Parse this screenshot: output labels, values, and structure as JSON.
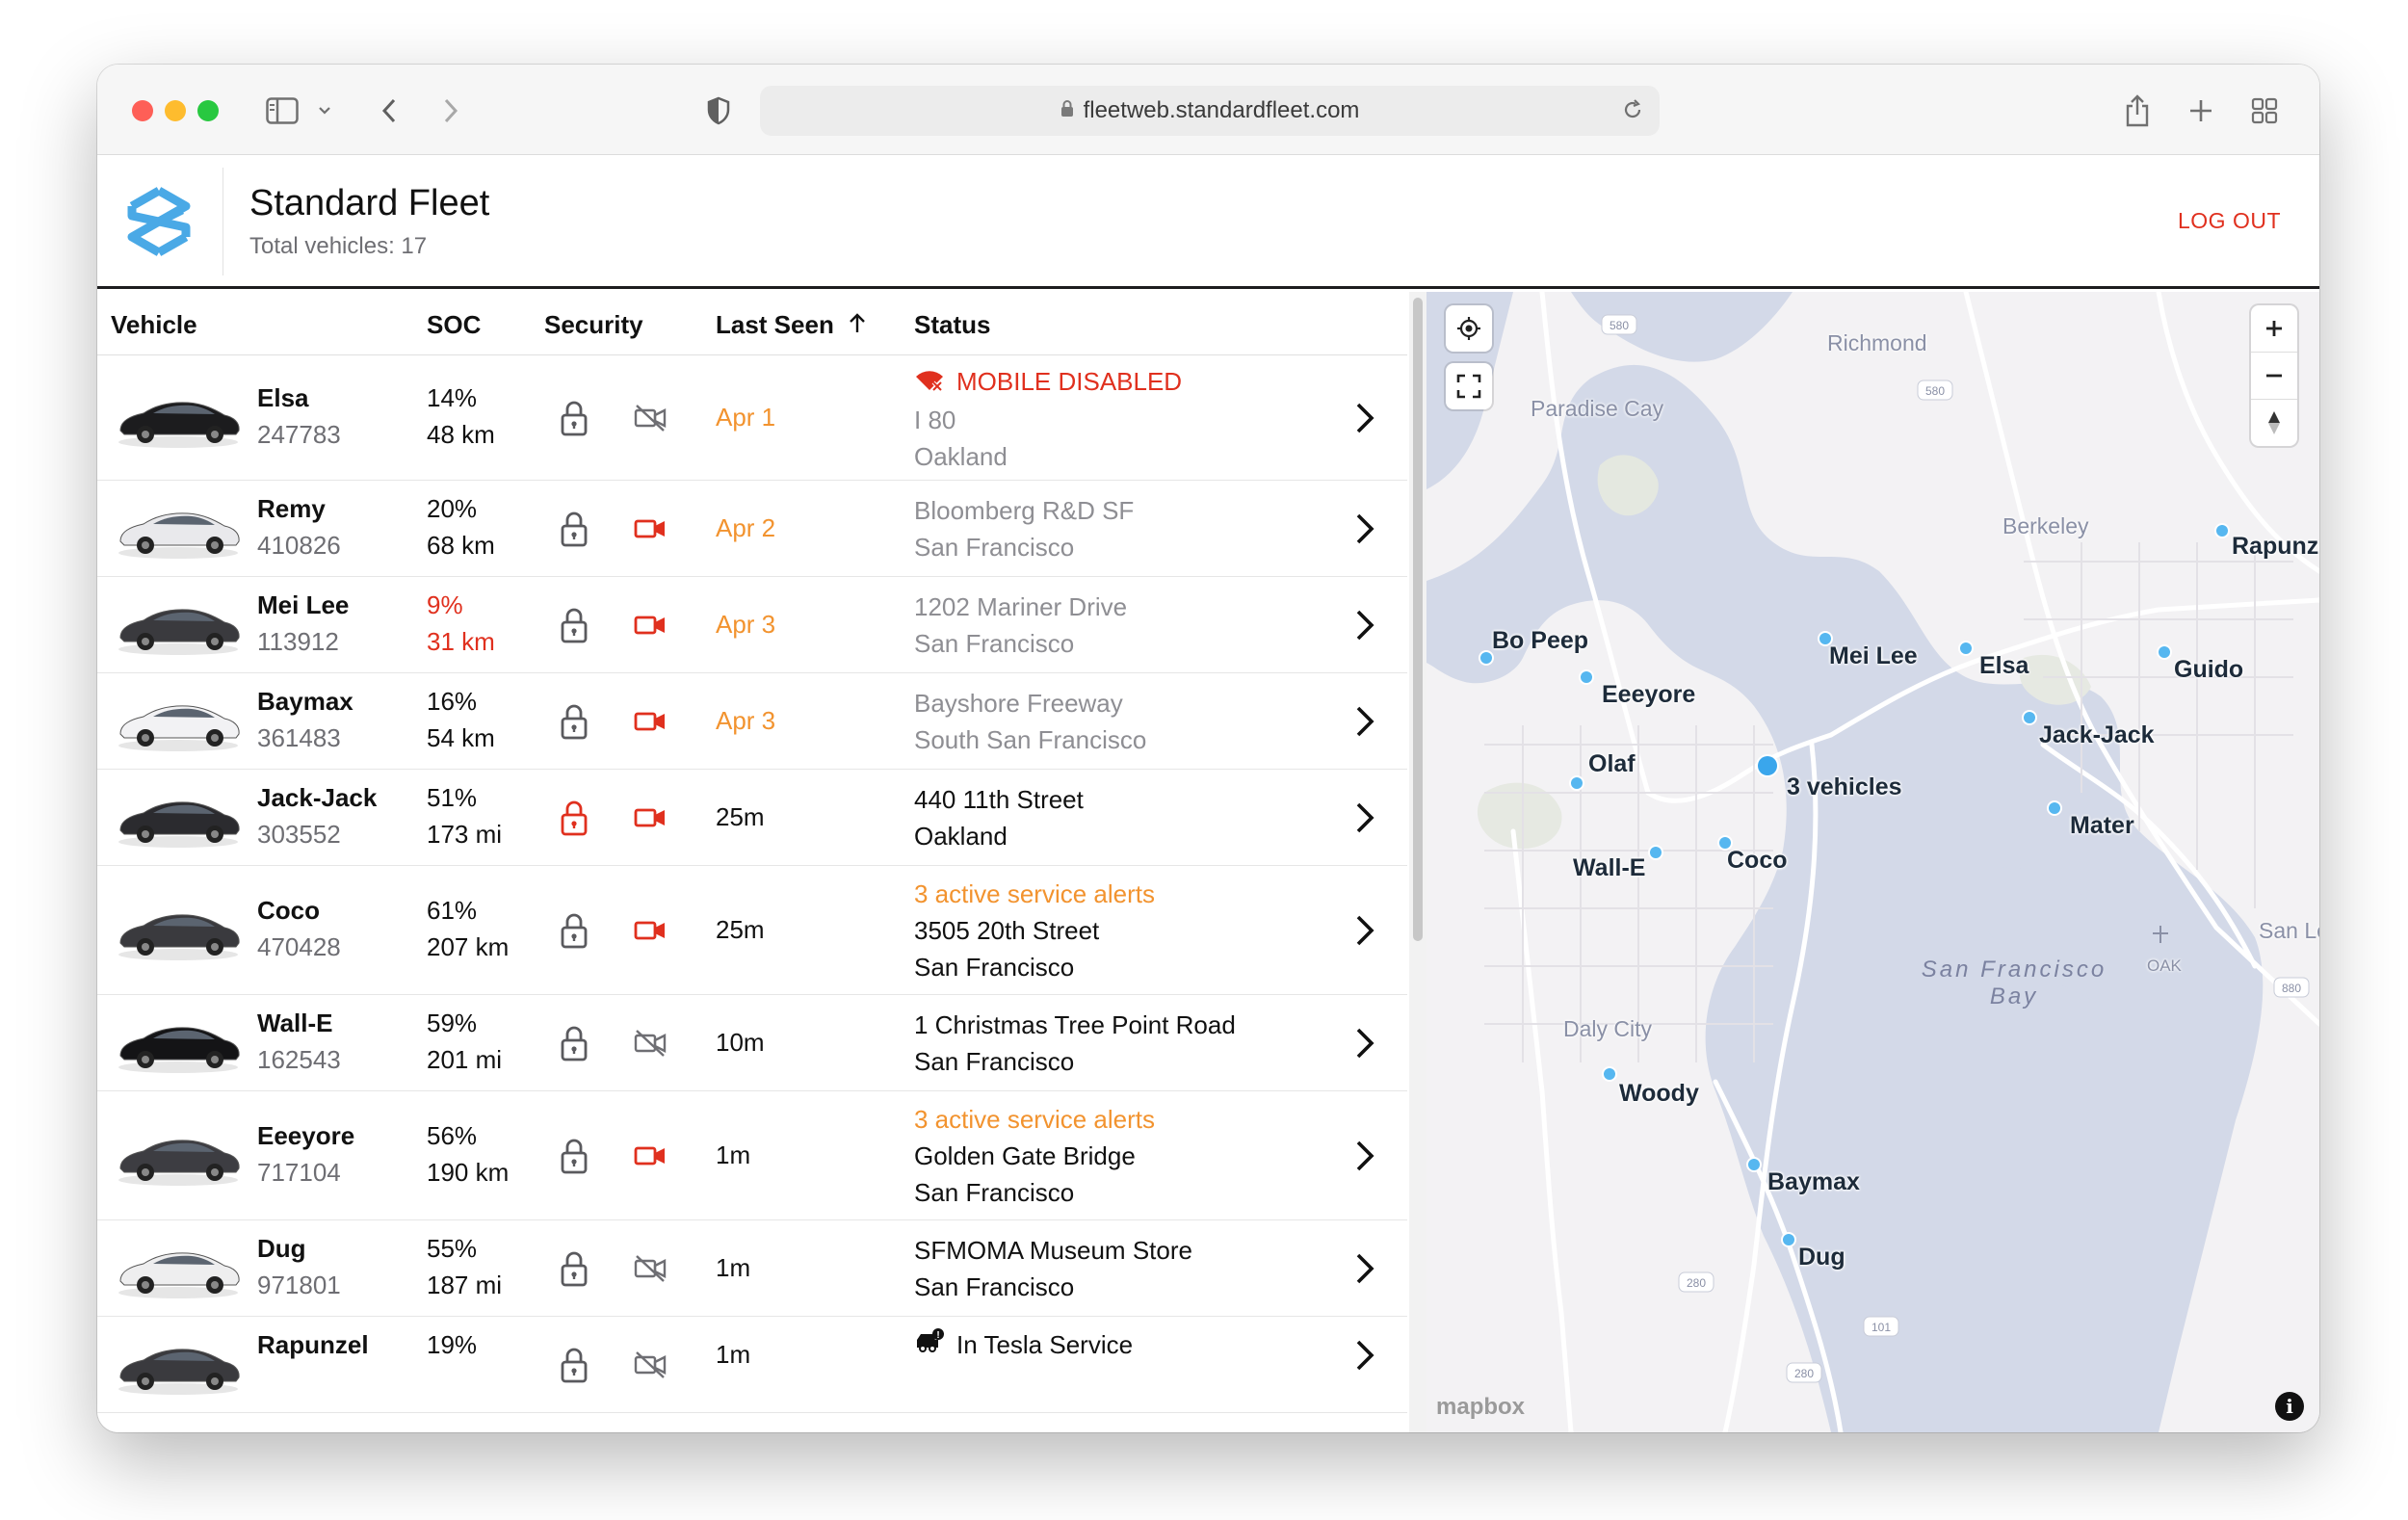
{
  "browser": {
    "url": "fleetweb.standardfleet.com"
  },
  "header": {
    "title": "Standard Fleet",
    "subtitle": "Total vehicles: 17",
    "logout": "LOG OUT"
  },
  "table": {
    "columns": {
      "vehicle": "Vehicle",
      "soc": "SOC",
      "security": "Security",
      "last_seen": "Last Seen",
      "status": "Status"
    },
    "rows": [
      {
        "name": "Elsa",
        "id": "247783",
        "soc_pct": "14%",
        "soc_range": "48 km",
        "soc_low": false,
        "locked_alert": false,
        "camera": "off",
        "seen": "Apr 1",
        "seen_warn": true,
        "status_alert": "MOBILE DISABLED",
        "status_line1": "I 80",
        "status_line2": "Oakland",
        "muted": true
      },
      {
        "name": "Remy",
        "id": "410826",
        "soc_pct": "20%",
        "soc_range": "68 km",
        "soc_low": false,
        "locked_alert": false,
        "camera": "alert",
        "seen": "Apr 2",
        "seen_warn": true,
        "status_line1": "Bloomberg R&D SF",
        "status_line2": "San Francisco",
        "muted": true
      },
      {
        "name": "Mei Lee",
        "id": "113912",
        "soc_pct": "9%",
        "soc_range": "31 km",
        "soc_low": true,
        "locked_alert": false,
        "camera": "alert",
        "seen": "Apr 3",
        "seen_warn": true,
        "status_line1": "1202 Mariner Drive",
        "status_line2": "San Francisco",
        "muted": true
      },
      {
        "name": "Baymax",
        "id": "361483",
        "soc_pct": "16%",
        "soc_range": "54 km",
        "soc_low": false,
        "locked_alert": false,
        "camera": "alert",
        "seen": "Apr 3",
        "seen_warn": true,
        "status_line1": "Bayshore Freeway",
        "status_line2": "South San Francisco",
        "muted": true
      },
      {
        "name": "Jack-Jack",
        "id": "303552",
        "soc_pct": "51%",
        "soc_range": "173 mi",
        "soc_low": false,
        "locked_alert": true,
        "camera": "alert",
        "seen": "25m",
        "seen_warn": false,
        "status_line1": "440 11th Street",
        "status_line2": "Oakland",
        "muted": false
      },
      {
        "name": "Coco",
        "id": "470428",
        "soc_pct": "61%",
        "soc_range": "207 km",
        "soc_low": false,
        "locked_alert": false,
        "camera": "alert",
        "seen": "25m",
        "seen_warn": false,
        "status_service": "3 active service alerts",
        "status_line1": "3505 20th Street",
        "status_line2": "San Francisco",
        "muted": false
      },
      {
        "name": "Wall-E",
        "id": "162543",
        "soc_pct": "59%",
        "soc_range": "201 mi",
        "soc_low": false,
        "locked_alert": false,
        "camera": "off",
        "seen": "10m",
        "seen_warn": false,
        "status_line1": "1 Christmas Tree Point Road",
        "status_line2": "San Francisco",
        "muted": false
      },
      {
        "name": "Eeeyore",
        "id": "717104",
        "soc_pct": "56%",
        "soc_range": "190 km",
        "soc_low": false,
        "locked_alert": false,
        "camera": "alert",
        "seen": "1m",
        "seen_warn": false,
        "status_service": "3 active service alerts",
        "status_line1": "Golden Gate Bridge",
        "status_line2": "San Francisco",
        "muted": false
      },
      {
        "name": "Dug",
        "id": "971801",
        "soc_pct": "55%",
        "soc_range": "187 mi",
        "soc_low": false,
        "locked_alert": false,
        "camera": "off",
        "seen": "1m",
        "seen_warn": false,
        "status_line1": "SFMOMA Museum Store",
        "status_line2": "San Francisco",
        "muted": false
      },
      {
        "name": "Rapunzel",
        "id": "",
        "soc_pct": "19%",
        "soc_range": "",
        "soc_low": false,
        "locked_alert": false,
        "camera": "off",
        "seen": "1m",
        "seen_warn": false,
        "status_tesla": "In Tesla Service",
        "status_line1": "",
        "status_line2": "",
        "muted": false
      }
    ]
  },
  "map": {
    "places": {
      "richmond": "Richmond",
      "paradise_cay": "Paradise Cay",
      "berkeley": "Berkeley",
      "daly_city": "Daly City",
      "san_leandro": "San Lea",
      "oak": "OAK"
    },
    "water": "San Francisco Bay",
    "vehicle_labels": {
      "rapunzel": "Rapunze",
      "bo_peep": "Bo Peep",
      "mei_lee": "Mei Lee",
      "elsa": "Elsa",
      "guido": "Guido",
      "eeeyore": "Eeeyore",
      "jack_jack": "Jack-Jack",
      "olaf": "Olaf",
      "three": "3 vehicles",
      "mater": "Mater",
      "wall_e": "Wall-E",
      "coco": "Coco",
      "woody": "Woody",
      "baymax": "Baymax",
      "dug": "Dug"
    },
    "highways": {
      "i580a": "580",
      "i580b": "580",
      "i880": "880",
      "i280a": "280",
      "i280b": "280",
      "us101": "101"
    },
    "attribution": "mapbox",
    "info": "i"
  },
  "colors": {
    "accent_red": "#e0301e",
    "warn_orange": "#f2932f",
    "muted_gray": "#8e8e93",
    "pin_blue": "#56b7f0",
    "logo_blue": "#4aa9e6"
  }
}
